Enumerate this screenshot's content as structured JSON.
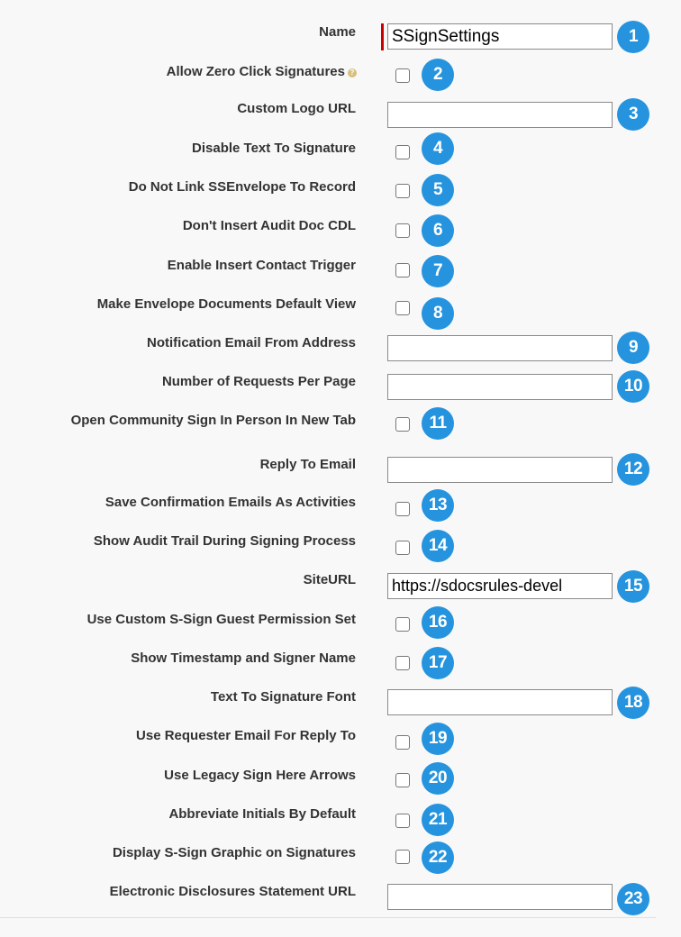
{
  "form": {
    "name": {
      "label": "Name",
      "value": "SSignSettings",
      "badge": "1"
    },
    "allow_zero_click": {
      "label": "Allow Zero Click Signatures",
      "help_icon": "?",
      "badge": "2"
    },
    "custom_logo_url": {
      "label": "Custom Logo URL",
      "value": "",
      "badge": "3"
    },
    "disable_text_to_signature": {
      "label": "Disable Text To Signature",
      "badge": "4"
    },
    "do_not_link_envelope": {
      "label": "Do Not Link SSEnvelope To Record",
      "badge": "5"
    },
    "dont_insert_audit_doc": {
      "label": "Don't Insert Audit Doc CDL",
      "badge": "6"
    },
    "enable_insert_contact_trigger": {
      "label": "Enable Insert Contact Trigger",
      "badge": "7"
    },
    "make_envelope_default_view": {
      "label": "Make Envelope Documents Default View",
      "badge": "8"
    },
    "notification_email_from": {
      "label": "Notification Email From Address",
      "value": "",
      "badge": "9"
    },
    "number_of_requests": {
      "label": "Number of Requests Per Page",
      "value": "",
      "badge": "10"
    },
    "open_community_sign": {
      "label": "Open Community Sign In Person In New Tab",
      "badge": "11"
    },
    "reply_to_email": {
      "label": "Reply To Email",
      "value": "",
      "badge": "12"
    },
    "save_confirmation_emails": {
      "label": "Save Confirmation Emails As Activities",
      "badge": "13"
    },
    "show_audit_trail": {
      "label": "Show Audit Trail During Signing Process",
      "badge": "14"
    },
    "site_url": {
      "label": "SiteURL",
      "value": "https://sdocsrules-devel",
      "badge": "15"
    },
    "use_custom_guest_permission": {
      "label": "Use Custom S-Sign Guest Permission Set",
      "badge": "16"
    },
    "show_timestamp_signer": {
      "label": "Show Timestamp and Signer Name",
      "badge": "17"
    },
    "text_to_signature_font": {
      "label": "Text To Signature Font",
      "value": "",
      "badge": "18"
    },
    "use_requester_email": {
      "label": "Use Requester Email For Reply To",
      "badge": "19"
    },
    "use_legacy_arrows": {
      "label": "Use Legacy Sign Here Arrows",
      "badge": "20"
    },
    "abbreviate_initials": {
      "label": "Abbreviate Initials By Default",
      "badge": "21"
    },
    "display_graphic": {
      "label": "Display S-Sign Graphic on Signatures",
      "badge": "22"
    },
    "electronic_disclosures_url": {
      "label": "Electronic Disclosures Statement URL",
      "value": "",
      "badge": "23"
    }
  },
  "colors": {
    "badge": "#2593de",
    "required_bar": "#cc0000",
    "label_text": "#333333",
    "background": "#f8f8f8"
  }
}
